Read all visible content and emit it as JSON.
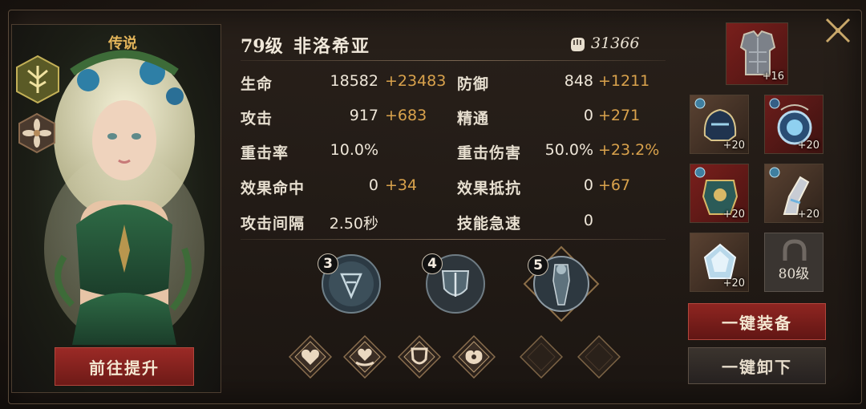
{
  "hero": {
    "rarity": "传说",
    "level": "79级",
    "name": "非洛希亚",
    "power": "31366"
  },
  "stats": [
    {
      "key": "hp",
      "label": "生命",
      "value": "18582",
      "bonus": "+23483"
    },
    {
      "key": "def",
      "label": "防御",
      "value": "848",
      "bonus": "+1211"
    },
    {
      "key": "atk",
      "label": "攻击",
      "value": "917",
      "bonus": "+683"
    },
    {
      "key": "mastery",
      "label": "精通",
      "value": "0",
      "bonus": "+271"
    },
    {
      "key": "crit-rate",
      "label": "重击率",
      "value": "10.0%",
      "bonus": ""
    },
    {
      "key": "crit-dmg",
      "label": "重击伤害",
      "value": "50.0%",
      "bonus": "+23.2%"
    },
    {
      "key": "accuracy",
      "label": "效果命中",
      "value": "0",
      "bonus": "+34"
    },
    {
      "key": "resist",
      "label": "效果抵抗",
      "value": "0",
      "bonus": "+67"
    },
    {
      "key": "atk-interval",
      "label": "攻击间隔",
      "value": "2.50秒",
      "bonus": ""
    },
    {
      "key": "haste",
      "label": "技能急速",
      "value": "0",
      "bonus": ""
    }
  ],
  "skills": [
    {
      "number": "3",
      "icon": "rune-sigil-icon"
    },
    {
      "number": "4",
      "icon": "shield-crest-icon"
    },
    {
      "number": "5",
      "icon": "knight-statue-icon"
    }
  ],
  "runes": [
    {
      "icon": "heart-icon",
      "filled": true
    },
    {
      "icon": "heart-hand-icon",
      "filled": true
    },
    {
      "icon": "shield-icon",
      "filled": true
    },
    {
      "icon": "muscle-icon",
      "filled": true
    },
    {
      "icon": "empty-slot",
      "filled": false
    },
    {
      "icon": "empty-slot",
      "filled": false
    }
  ],
  "equipment": {
    "armor": {
      "plus": "+16"
    },
    "slots": [
      {
        "name": "helmet",
        "plus": "+20"
      },
      {
        "name": "amulet",
        "plus": "+20"
      },
      {
        "name": "chest",
        "plus": "+20"
      },
      {
        "name": "gauntlet",
        "plus": "+20"
      },
      {
        "name": "crystal",
        "plus": "+20"
      }
    ],
    "locked_label": "80级"
  },
  "buttons": {
    "upgrade": "前往提升",
    "equip_all": "一键装备",
    "unequip_all": "一键卸下"
  },
  "colors": {
    "bonus": "#d9a24c",
    "rarity": "#e3b55a",
    "primary_button": "#8a2420"
  }
}
